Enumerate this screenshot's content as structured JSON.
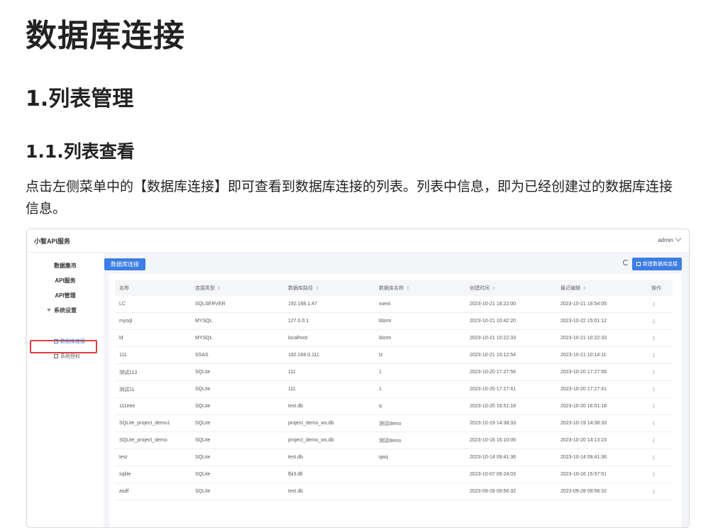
{
  "doc": {
    "h1": "数据库连接",
    "h2": "1.列表管理",
    "h3": "1.1.列表查看",
    "paragraph": "点击左侧菜单中的【数据库连接】即可查看到数据库连接的列表。列表中信息，即为已经创建过的数据库连接信息。"
  },
  "app": {
    "brand": "小智API服务",
    "user": "admin",
    "sidebar": {
      "items": [
        "数据集市",
        "API服务",
        "API管理"
      ],
      "group": "系统设置",
      "sub_active": "数据库连接",
      "sub_other": "系统授权"
    },
    "tag": "数据库连接",
    "new_button": "新建数据库连接",
    "table": {
      "headers": [
        "名称",
        "连接类型",
        "数据库路径",
        "数据库名称",
        "创建时间",
        "最近编辑",
        "操作"
      ],
      "rows": [
        [
          "LC",
          "SQLSERVER",
          "192.168.1.47",
          "xuexi",
          "2023-10-21 18:22:00",
          "2023-10-21 18:54:05"
        ],
        [
          "mysql",
          "MYSQL",
          "127.0.0.1",
          "ldorm",
          "2023-10-21 10:42:20",
          "2023-10-22 15:01:12"
        ],
        [
          "ld",
          "MYSQL",
          "localhost",
          "ldorm",
          "2023-10-21 10:22:33",
          "2023-10-21 10:22:33"
        ],
        [
          "111",
          "SSAS",
          "192.168.0.111",
          "tz",
          "2023-10-21 10:12:54",
          "2023-10-21 10:14:11"
        ],
        [
          "测试113",
          "SQLite",
          "111",
          "1",
          "2023-10-20 17:27:56",
          "2023-10-20 17:27:56"
        ],
        [
          "测试11",
          "SQLite",
          "111",
          "1",
          "2023-10-20 17:27:41",
          "2023-10-20 17:27:41"
        ],
        [
          "111eee",
          "SQLite",
          "test.db",
          "q",
          "2023-10-20 16:51:18",
          "2023-10-20 16:51:18"
        ],
        [
          "SQLite_project_demo1",
          "SQLite",
          "project_demo_ws.db",
          "测试demo",
          "2023-10-19 14:38:33",
          "2023-10-19 14:38:33"
        ],
        [
          "SQLite_project_demo",
          "SQLite",
          "project_demo_ws.db",
          "测试demo",
          "2023-10-16 16:10:06",
          "2023-10-20 14:13:23"
        ],
        [
          "test",
          "SQLite",
          "test.db",
          "qwq",
          "2023-10-14 09:41:36",
          "2023-10-14 09:41:36"
        ],
        [
          "sqlite",
          "SQLite",
          "fbi3.dll",
          "",
          "2023-10-07 09:24:03",
          "2023-10-16 15:57:51"
        ],
        [
          "asdf",
          "SQLite",
          "test.db",
          "",
          "2023-09-28 09:56:32",
          "2023-09-28 09:56:32"
        ]
      ],
      "action_glyph": "⋮"
    }
  }
}
